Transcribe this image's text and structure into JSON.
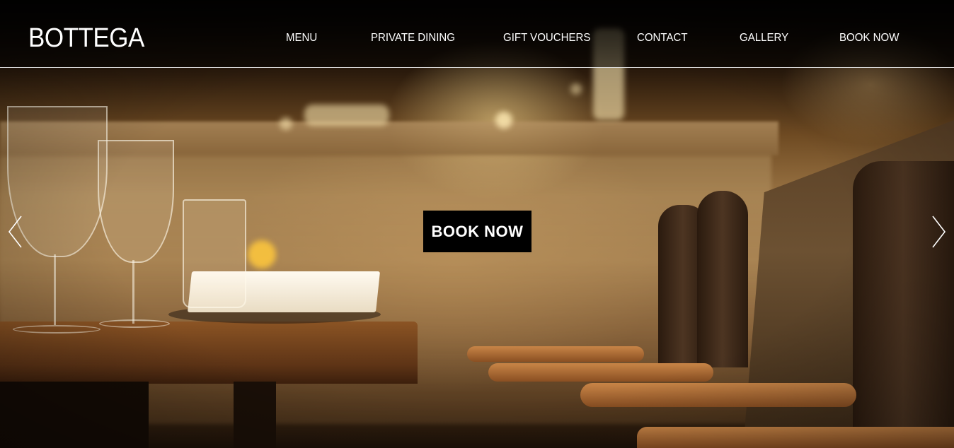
{
  "header": {
    "logo": "BOTTEGA",
    "nav": [
      {
        "label": "MENU"
      },
      {
        "label": "PRIVATE DINING"
      },
      {
        "label": "GIFT VOUCHERS"
      },
      {
        "label": "CONTACT"
      },
      {
        "label": "GALLERY"
      },
      {
        "label": "BOOK NOW"
      }
    ]
  },
  "hero": {
    "cta_label": "BOOK NOW",
    "prev_icon": "chevron-left-icon",
    "next_icon": "chevron-right-icon"
  },
  "colors": {
    "header_bg": "#000000",
    "text": "#ffffff",
    "cta_bg": "#000000",
    "warm_accent": "#9a7444"
  }
}
